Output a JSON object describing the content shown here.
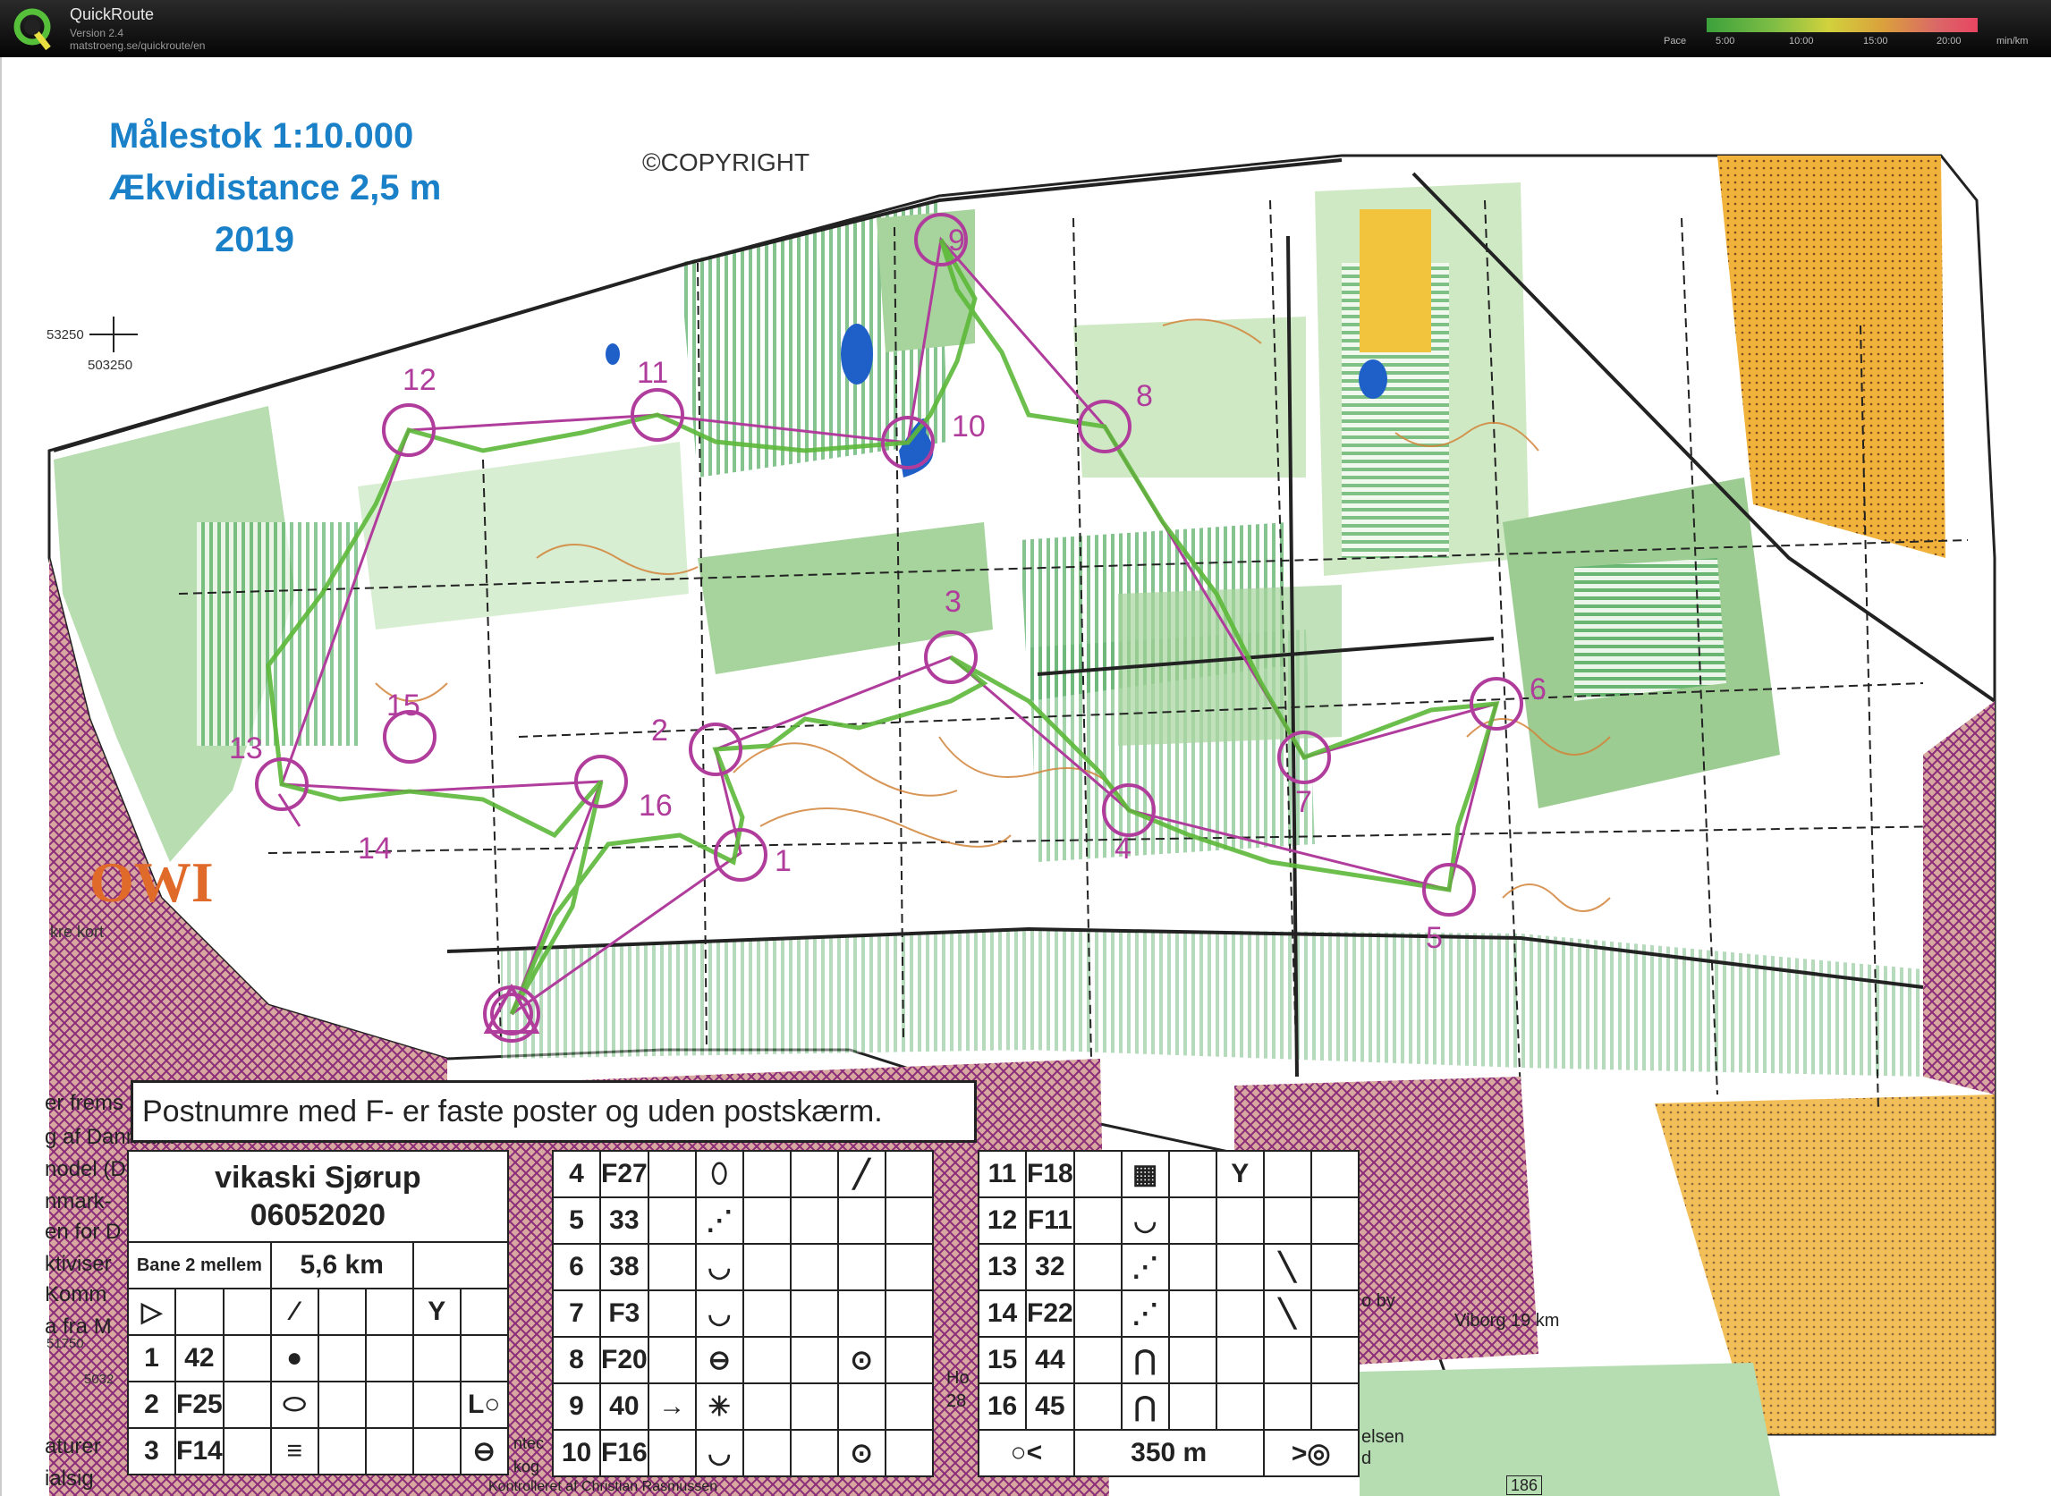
{
  "app": {
    "title": "QuickRoute",
    "version": "Version 2.4",
    "url": "matstroeng.se/quickroute/en",
    "pace_label": "Pace",
    "pace_ticks": [
      "5:00",
      "10:00",
      "15:00",
      "20:00"
    ],
    "pace_unit": "min/km",
    "pace_gradient_colors": [
      "#3fb03f",
      "#8bd04a",
      "#e6e640",
      "#f0b040",
      "#f07070",
      "#ff4a6a"
    ]
  },
  "map": {
    "scale_text": "Målestok 1:10.000",
    "contour_text": "Ækvidistance 2,5 m",
    "year_text": "2019",
    "copyright_text": "©COPYRIGHT",
    "grid_label_top_a": "53250",
    "grid_label_top_b": "503250",
    "grid_label_bottom_a": "51750",
    "grid_label_bottom_b": "5032",
    "logo_fragment": "OWI",
    "logo_caption": "kre kort",
    "road_sign": "Viborg 19 km",
    "road_number": "186",
    "side_text_right": "o by",
    "side_text_right2": "elsen",
    "side_text_right3": "d",
    "left_fragments": [
      "er frems",
      "g af Danmark",
      "nodel (D",
      "nmark-",
      "en for D",
      "ktiviser",
      "Komm",
      "a fra M",
      "aturer",
      "ialsig"
    ],
    "middle_fragments": [
      "Ho",
      "28",
      "ntec",
      "kog"
    ],
    "bottom_fragment": "Kontrolleret af Christian Rasmussen",
    "route_color": "#5cb838",
    "course_color": "#b03c9c",
    "controls": [
      {
        "num": "1"
      },
      {
        "num": "2"
      },
      {
        "num": "3"
      },
      {
        "num": "4"
      },
      {
        "num": "5"
      },
      {
        "num": "6"
      },
      {
        "num": "7"
      },
      {
        "num": "8"
      },
      {
        "num": "9"
      },
      {
        "num": "10"
      },
      {
        "num": "11"
      },
      {
        "num": "12"
      },
      {
        "num": "13"
      },
      {
        "num": "14"
      },
      {
        "num": "15"
      },
      {
        "num": "16"
      }
    ]
  },
  "description": {
    "note": "Postnumre med F- er faste poster og uden postskærm.",
    "event_name": "vikaski Sjørup",
    "event_date": "06052020",
    "course_name": "Bane 2 mellem",
    "course_length": "5,6 km",
    "finish_distance": "350 m",
    "rows": [
      {
        "n": "1",
        "code": "42",
        "sym": "●",
        "extra": ""
      },
      {
        "n": "2",
        "code": "F25",
        "sym": "⬭",
        "extra": "L○"
      },
      {
        "n": "3",
        "code": "F14",
        "sym": "≡",
        "extra": "⊖"
      },
      {
        "n": "4",
        "code": "F27",
        "sym": "⬯",
        "extra": "╱"
      },
      {
        "n": "5",
        "code": "33",
        "sym": "⋰",
        "extra": ""
      },
      {
        "n": "6",
        "code": "38",
        "sym": "◡",
        "extra": ""
      },
      {
        "n": "7",
        "code": "F3",
        "sym": "◡",
        "extra": ""
      },
      {
        "n": "8",
        "code": "F20",
        "sym": "⊖",
        "extra": "⊙"
      },
      {
        "n": "9",
        "code": "40",
        "sym": "✳",
        "extra": ""
      },
      {
        "n": "10",
        "code": "F16",
        "sym": "◡",
        "extra": "⊙"
      },
      {
        "n": "11",
        "code": "F18",
        "sym": "▦",
        "extra": "Y"
      },
      {
        "n": "12",
        "code": "F11",
        "sym": "◡",
        "extra": ""
      },
      {
        "n": "13",
        "code": "32",
        "sym": "⋰",
        "extra": "╲"
      },
      {
        "n": "14",
        "code": "F22",
        "sym": "⋰",
        "extra": "╲"
      },
      {
        "n": "15",
        "code": "44",
        "sym": "⋂",
        "extra": ""
      },
      {
        "n": "16",
        "code": "45",
        "sym": "⋂",
        "extra": ""
      }
    ]
  }
}
